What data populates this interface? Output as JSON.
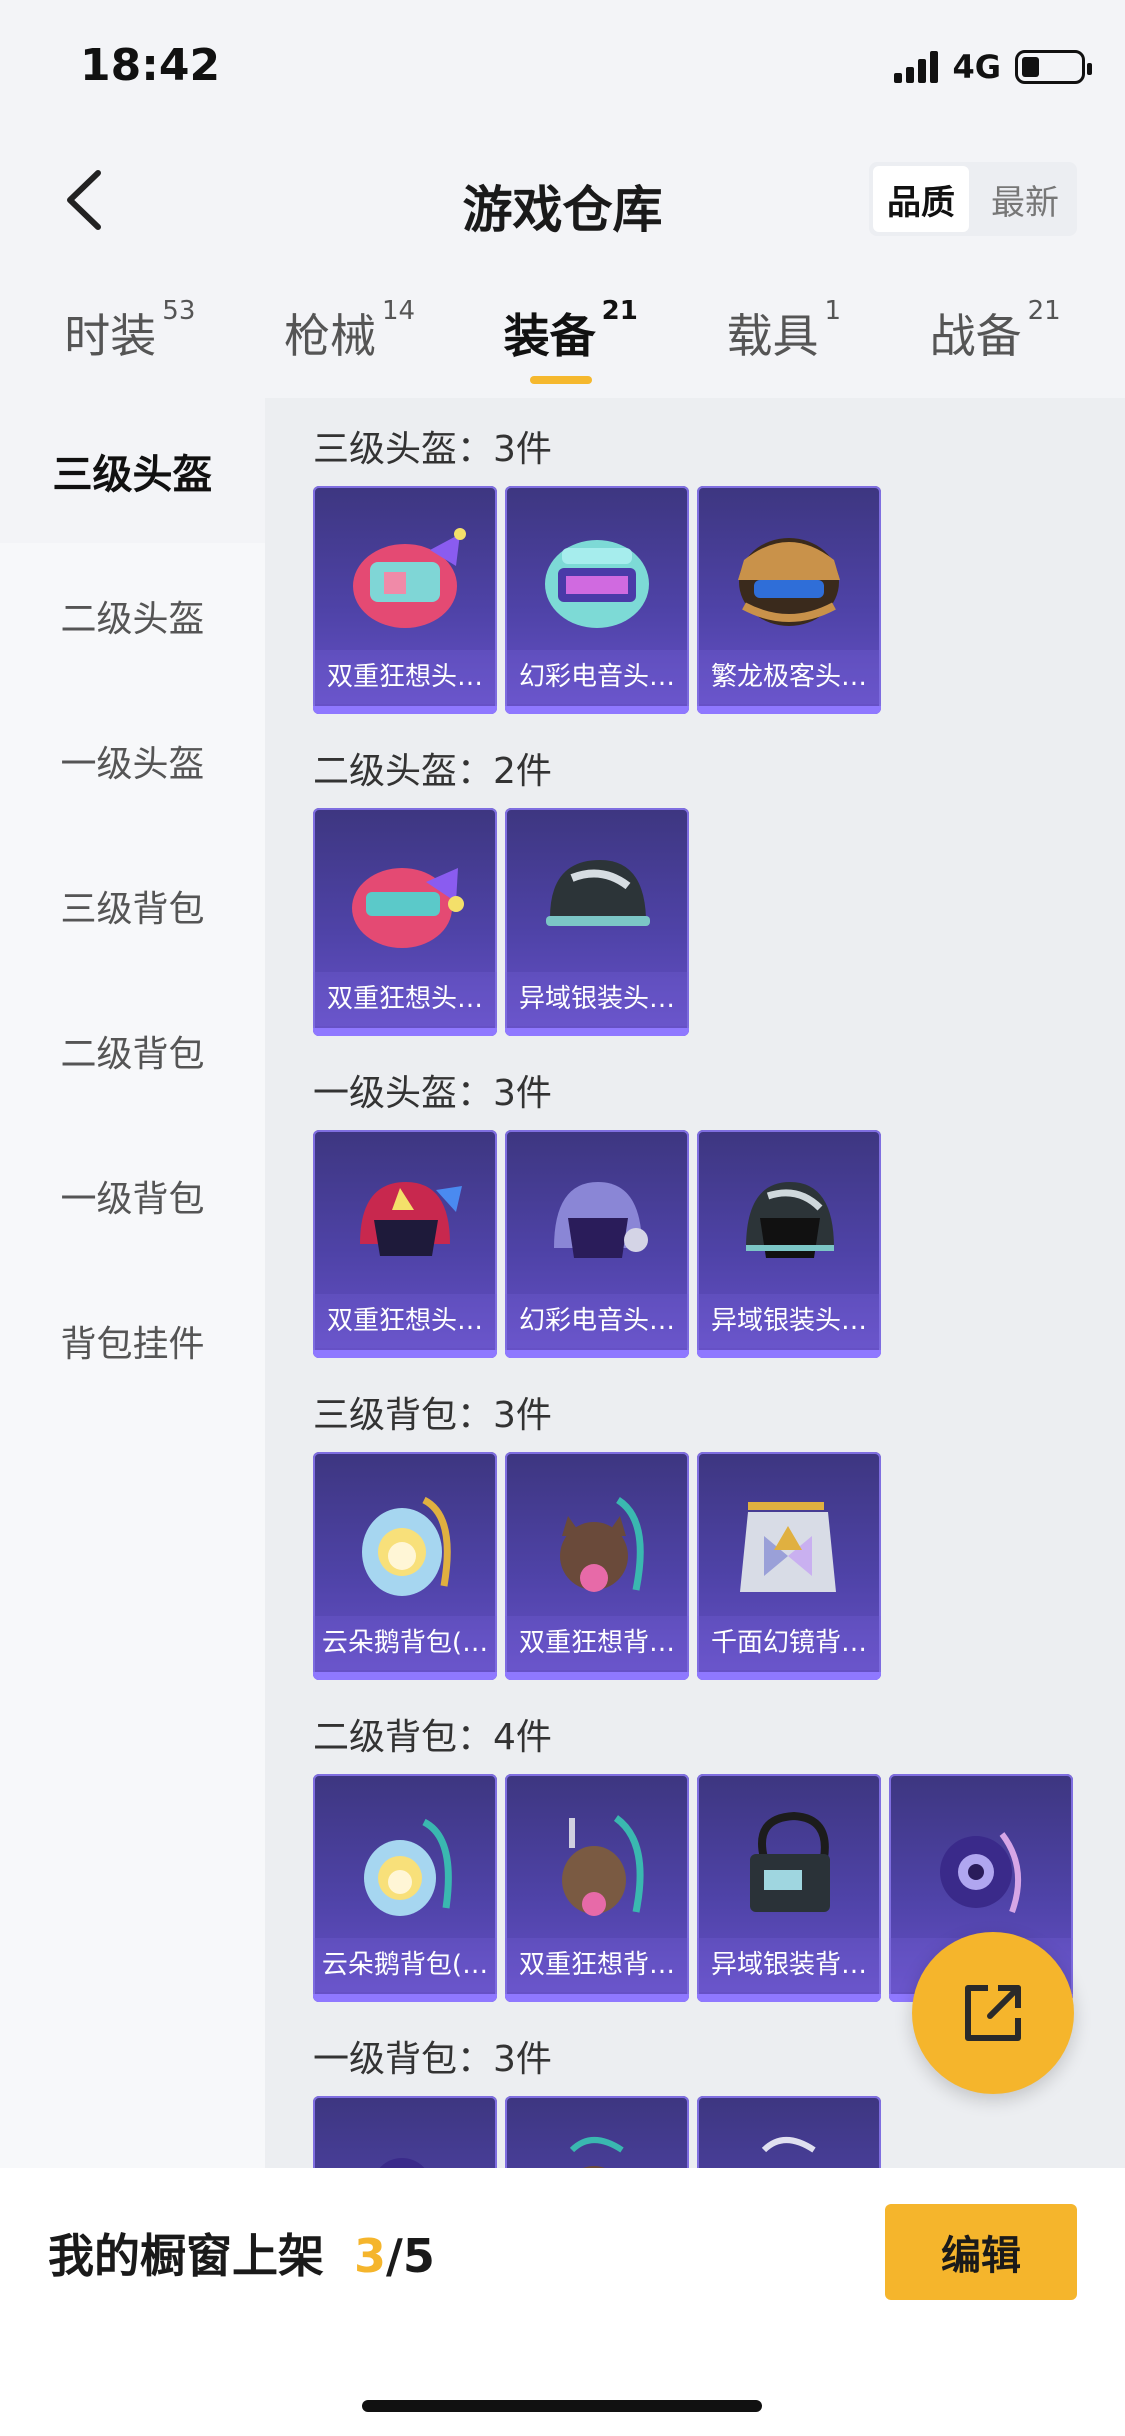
{
  "status": {
    "time": "18:42",
    "network": "4G"
  },
  "header": {
    "title": "游戏仓库",
    "sort_options": [
      "品质",
      "最新"
    ]
  },
  "tabs": [
    {
      "label": "时装",
      "count": "53"
    },
    {
      "label": "枪械",
      "count": "14"
    },
    {
      "label": "装备",
      "count": "21"
    },
    {
      "label": "载具",
      "count": "1"
    },
    {
      "label": "战备",
      "count": "21"
    }
  ],
  "active_tab": "装备",
  "sidebar": {
    "items": [
      "三级头盔",
      "二级头盔",
      "一级头盔",
      "三级背包",
      "二级背包",
      "一级背包",
      "背包挂件"
    ],
    "active": "三级头盔"
  },
  "sections": [
    {
      "title": "三级头盔：3件",
      "items": [
        "双重狂想头…",
        "幻彩电音头…",
        "繁龙极客头…"
      ]
    },
    {
      "title": "二级头盔：2件",
      "items": [
        "双重狂想头…",
        "异域银装头…"
      ]
    },
    {
      "title": "一级头盔：3件",
      "items": [
        "双重狂想头…",
        "幻彩电音头…",
        "异域银装头…"
      ]
    },
    {
      "title": "三级背包：3件",
      "items": [
        "云朵鹅背包(…",
        "双重狂想背…",
        "千面幻镜背…"
      ]
    },
    {
      "title": "二级背包：4件",
      "items": [
        "云朵鹅背包(…",
        "双重狂想背…",
        "异域银装背…",
        "幻彩…"
      ]
    },
    {
      "title": "一级背包：3件",
      "items": [
        "",
        "",
        ""
      ]
    }
  ],
  "bottom": {
    "showcase_label": "我的橱窗上架",
    "showcase_current": "3",
    "showcase_total": "/5",
    "edit_label": "编辑"
  },
  "colors": {
    "accent": "#f5b52c",
    "card": "#4f43a8"
  }
}
